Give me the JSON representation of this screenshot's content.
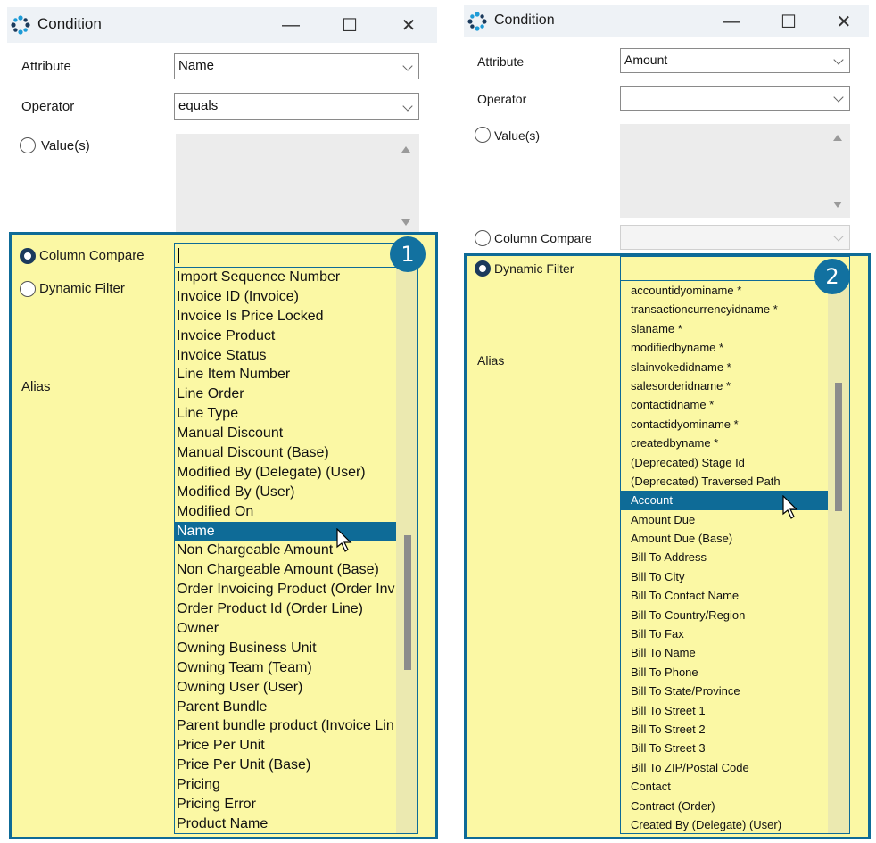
{
  "panels": [
    {
      "title": "Condition",
      "attribute_label": "Attribute",
      "attribute_value": "Name",
      "operator_label": "Operator",
      "operator_value": "equals",
      "values_label": "Value(s)",
      "column_compare_label": "Column Compare",
      "dynamic_filter_label": "Dynamic Filter",
      "alias_label": "Alias",
      "selected_radio": "Column Compare",
      "badge": "1",
      "list_items": [
        "Import Sequence Number",
        "Invoice ID (Invoice)",
        "Invoice Is Price Locked",
        "Invoice Product",
        "Invoice Status",
        "Line Item Number",
        "Line Order",
        "Line Type",
        "Manual Discount",
        "Manual Discount (Base)",
        "Modified By (Delegate) (User)",
        "Modified By (User)",
        "Modified On",
        "Name",
        "Non Chargeable Amount",
        "Non Chargeable Amount (Base)",
        "Order Invoicing Product (Order Inv",
        "Order Product Id (Order Line)",
        "Owner",
        "Owning Business Unit",
        "Owning Team (Team)",
        "Owning User (User)",
        "Parent Bundle",
        "Parent bundle product (Invoice Lin",
        "Price Per Unit",
        "Price Per Unit (Base)",
        "Pricing",
        "Pricing Error",
        "Product Name"
      ],
      "selected_item": "Name"
    },
    {
      "title": "Condition",
      "attribute_label": "Attribute",
      "attribute_value": "Amount",
      "operator_label": "Operator",
      "operator_value": "",
      "values_label": "Value(s)",
      "column_compare_label": "Column Compare",
      "dynamic_filter_label": "Dynamic Filter",
      "alias_label": "Alias",
      "selected_radio": "Dynamic Filter",
      "badge": "2",
      "list_items": [
        "accountidyominame *",
        "transactioncurrencyidname *",
        "slaname *",
        "modifiedbyname *",
        "slainvokedidname *",
        "salesorderidname *",
        "contactidname *",
        "contactidyominame *",
        "createdbyname *",
        "(Deprecated) Stage Id",
        "(Deprecated) Traversed Path",
        "Account",
        "Amount Due",
        "Amount Due (Base)",
        "Bill To Address",
        "Bill To City",
        "Bill To Contact Name",
        "Bill To Country/Region",
        "Bill To Fax",
        "Bill To Name",
        "Bill To Phone",
        "Bill To State/Province",
        "Bill To Street 1",
        "Bill To Street 2",
        "Bill To Street 3",
        "Bill To ZIP/Postal Code",
        "Contact",
        "Contract (Order)",
        "Created By (Delegate) (User)"
      ],
      "selected_item": "Account"
    }
  ],
  "window_controls": {
    "minimize": "—",
    "maximize": "☐",
    "close": "✕"
  },
  "colors": {
    "highlight_fill": "#fbf8a4",
    "accent": "#0e6b97",
    "badge": "#1271a0"
  }
}
